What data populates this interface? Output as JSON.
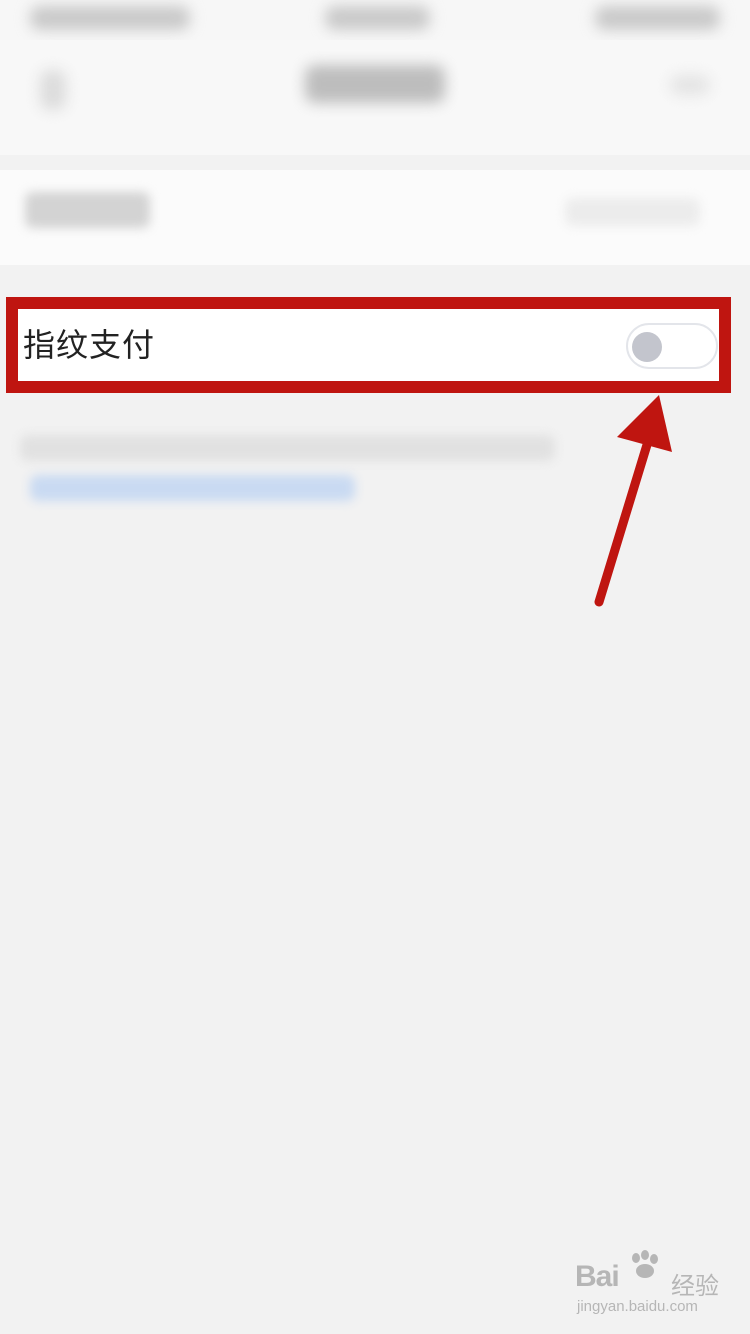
{
  "setting": {
    "label": "指纹支付",
    "enabled": false
  },
  "watermark": {
    "brand": "Bai",
    "brand_suffix": "经验",
    "url": "jingyan.baidu.com"
  },
  "colors": {
    "highlight": "#bf1510",
    "toggle_off_knob": "#c3c5cd",
    "background": "#f2f2f2"
  }
}
